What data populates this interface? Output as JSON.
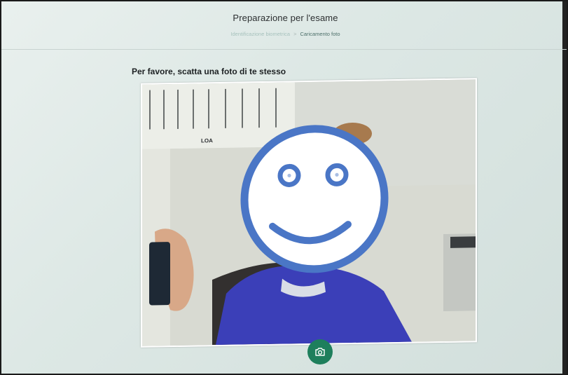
{
  "header": {
    "title": "Preparazione per l'esame",
    "breadcrumb": {
      "step1": "Identificazione biometrica",
      "separator": ">",
      "step2": "Caricamento foto"
    }
  },
  "main": {
    "instruction": "Per favore, scatta una foto di te stesso",
    "camera_feed": {
      "wall_sign_text": "LOA",
      "overlay": "smiley-face"
    },
    "capture_button_icon": "camera-icon"
  },
  "colors": {
    "accent_green": "#1e7f5c",
    "smiley_blue": "#4a76c6",
    "sweater_blue": "#3b3fb8"
  }
}
